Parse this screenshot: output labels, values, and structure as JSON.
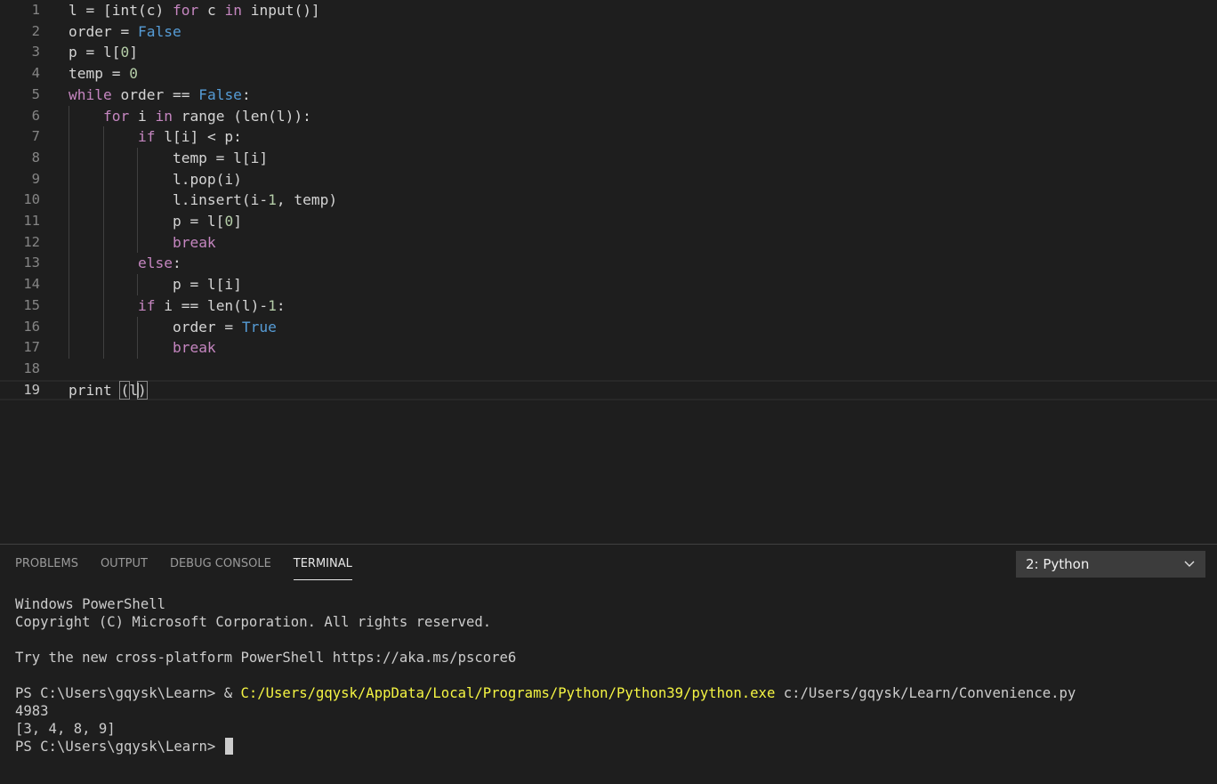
{
  "editor": {
    "lines": [
      {
        "num": "1",
        "tokens": [
          [
            "l = [",
            ""
          ],
          [
            "int",
            ""
          ],
          [
            "(c) ",
            ""
          ],
          [
            "for",
            "kw"
          ],
          [
            " c ",
            ""
          ],
          [
            "in",
            "kw"
          ],
          [
            " input()]",
            ""
          ]
        ]
      },
      {
        "num": "2",
        "tokens": [
          [
            "order = ",
            ""
          ],
          [
            "False",
            "const"
          ]
        ]
      },
      {
        "num": "3",
        "tokens": [
          [
            "p = l[",
            ""
          ],
          [
            "0",
            "num"
          ],
          [
            "]",
            ""
          ]
        ]
      },
      {
        "num": "4",
        "tokens": [
          [
            "temp = ",
            ""
          ],
          [
            "0",
            "num"
          ]
        ]
      },
      {
        "num": "5",
        "tokens": [
          [
            "while",
            "kw"
          ],
          [
            " order == ",
            ""
          ],
          [
            "False",
            "const"
          ],
          [
            ":",
            ""
          ]
        ]
      },
      {
        "num": "6",
        "tokens": [
          [
            "    ",
            ""
          ],
          [
            "for",
            "kw"
          ],
          [
            " i ",
            ""
          ],
          [
            "in",
            "kw"
          ],
          [
            " range (len(l)):",
            ""
          ]
        ]
      },
      {
        "num": "7",
        "tokens": [
          [
            "        ",
            ""
          ],
          [
            "if",
            "kw"
          ],
          [
            " l[i] < p:",
            ""
          ]
        ]
      },
      {
        "num": "8",
        "tokens": [
          [
            "            temp = l[i]",
            ""
          ]
        ]
      },
      {
        "num": "9",
        "tokens": [
          [
            "            l.pop(i)",
            ""
          ]
        ]
      },
      {
        "num": "10",
        "tokens": [
          [
            "            l.insert(i-",
            ""
          ],
          [
            "1",
            "num"
          ],
          [
            ", temp)",
            ""
          ]
        ]
      },
      {
        "num": "11",
        "tokens": [
          [
            "            p = l[",
            ""
          ],
          [
            "0",
            "num"
          ],
          [
            "]",
            ""
          ]
        ]
      },
      {
        "num": "12",
        "tokens": [
          [
            "            ",
            ""
          ],
          [
            "break",
            "kw"
          ]
        ]
      },
      {
        "num": "13",
        "tokens": [
          [
            "        ",
            ""
          ],
          [
            "else",
            "kw"
          ],
          [
            ":",
            ""
          ]
        ]
      },
      {
        "num": "14",
        "tokens": [
          [
            "            p = l[i]",
            ""
          ]
        ]
      },
      {
        "num": "15",
        "tokens": [
          [
            "        ",
            ""
          ],
          [
            "if",
            "kw"
          ],
          [
            " i == len(l)-",
            ""
          ],
          [
            "1",
            "num"
          ],
          [
            ":",
            ""
          ]
        ]
      },
      {
        "num": "16",
        "tokens": [
          [
            "            order = ",
            ""
          ],
          [
            "True",
            "const"
          ]
        ]
      },
      {
        "num": "17",
        "tokens": [
          [
            "            ",
            ""
          ],
          [
            "break",
            "kw"
          ]
        ]
      },
      {
        "num": "18",
        "tokens": []
      },
      {
        "num": "19",
        "tokens": [
          [
            "print ",
            ""
          ],
          [
            "(",
            "bhl"
          ],
          [
            "l",
            ""
          ],
          [
            ")",
            "bhl"
          ]
        ]
      }
    ],
    "current_line": "19"
  },
  "panel": {
    "tabs": [
      {
        "label": "PROBLEMS",
        "name": "tab-problems",
        "active": false
      },
      {
        "label": "OUTPUT",
        "name": "tab-output",
        "active": false
      },
      {
        "label": "DEBUG CONSOLE",
        "name": "tab-debug-console",
        "active": false
      },
      {
        "label": "TERMINAL",
        "name": "tab-terminal",
        "active": true
      }
    ],
    "terminal_selector": "2: Python"
  },
  "terminal": {
    "lines": [
      [
        [
          "Windows PowerShell",
          ""
        ]
      ],
      [
        [
          "Copyright (C) Microsoft Corporation. All rights reserved.",
          ""
        ]
      ],
      [],
      [
        [
          "Try the new cross-platform PowerShell https://aka.ms/pscore6",
          ""
        ]
      ],
      [],
      [
        [
          "PS C:\\Users\\gqysk\\Learn> & ",
          ""
        ],
        [
          "C:/Users/gqysk/AppData/Local/Programs/Python/Python39/python.exe",
          "yellow"
        ],
        [
          " c:/Users/gqysk/Learn/Convenience.py",
          ""
        ]
      ],
      [
        [
          "4983",
          ""
        ]
      ],
      [
        [
          "[3, 4, 8, 9]",
          ""
        ]
      ],
      [
        [
          "PS C:\\Users\\gqysk\\Learn> ",
          ""
        ]
      ]
    ]
  }
}
